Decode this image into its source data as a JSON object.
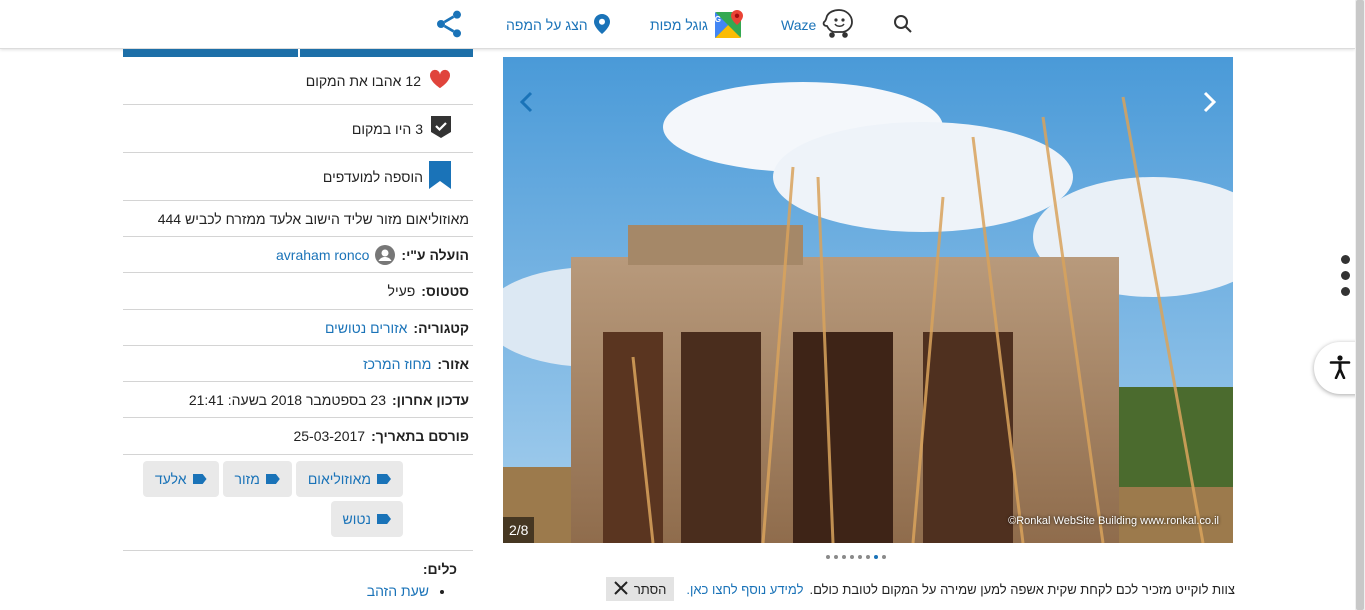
{
  "topbar": {
    "waze_label": "Waze",
    "google_maps_label": "גוגל מפות",
    "show_on_map_label": "הצג על המפה",
    "search_icon": "search-icon",
    "share_icon": "share-icon"
  },
  "info": {
    "likes_count": "12",
    "likes_text": "אהבו את המקום",
    "visited_count": "3",
    "visited_text": "היו במקום",
    "favorites_text": "הוספה למועדפים",
    "description": "מאוזוליאום מזור שליד הישוב אלעד ממזרח לכביש 444",
    "uploaded_by_label": "הועלה ע\"י:",
    "uploaded_by_user": "avraham ronco",
    "status_label": "סטטוס:",
    "status_value": "פעיל",
    "category_label": "קטגוריה:",
    "category_value": "אזורים נטושים",
    "region_label": "אזור:",
    "region_value": "מחוז המרכז",
    "updated_label": "עדכון אחרון:",
    "updated_value": "23 בספטמבר 2018 בשעה: 21:41",
    "published_label": "פורסם בתאריך:",
    "published_value": "25-03-2017",
    "tags": [
      "מאוזוליאום",
      "מזור",
      "אלעד",
      "נטוש"
    ],
    "tools_label": "כלים:",
    "tools_items": [
      "שעת הזהב"
    ]
  },
  "slider": {
    "counter": "2/8",
    "credit": "©Ronkal WebSite Building  www.ronkal.co.il",
    "total_dots": 8,
    "active_dot": 1
  },
  "notice": {
    "text": "צוות לוקייט מזכיר לכם לקחת שקית אשפה למען שמירה על המקום לטובת כולם.",
    "link_text": "למידע נוסף לחצו כאן.",
    "hide_label": "הסתר"
  },
  "colors": {
    "accent": "#1a73b8",
    "heart": "#e0443c",
    "tab_bar": "#1d6fa8"
  }
}
